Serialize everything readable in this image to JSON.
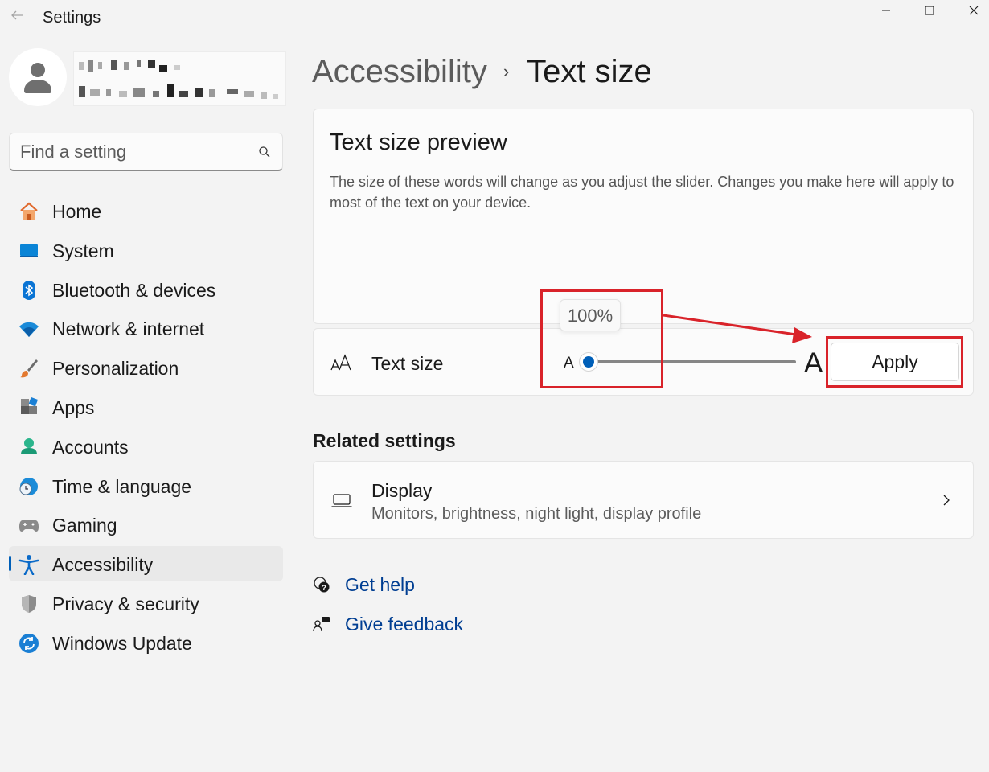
{
  "window": {
    "title": "Settings",
    "back_icon": "arrow-left-icon",
    "controls": [
      "minimize-icon",
      "maximize-icon",
      "close-icon"
    ]
  },
  "search": {
    "placeholder": "Find a setting",
    "icon": "search-icon"
  },
  "sidebar": {
    "items": [
      {
        "label": "Home",
        "icon": "home-icon"
      },
      {
        "label": "System",
        "icon": "monitor-icon"
      },
      {
        "label": "Bluetooth & devices",
        "icon": "bluetooth-icon"
      },
      {
        "label": "Network & internet",
        "icon": "wifi-icon"
      },
      {
        "label": "Personalization",
        "icon": "brush-icon"
      },
      {
        "label": "Apps",
        "icon": "apps-icon"
      },
      {
        "label": "Accounts",
        "icon": "person-icon"
      },
      {
        "label": "Time & language",
        "icon": "clock-globe-icon"
      },
      {
        "label": "Gaming",
        "icon": "gamepad-icon"
      },
      {
        "label": "Accessibility",
        "icon": "accessibility-icon",
        "active": true
      },
      {
        "label": "Privacy & security",
        "icon": "shield-icon"
      },
      {
        "label": "Windows Update",
        "icon": "update-icon"
      }
    ]
  },
  "breadcrumb": {
    "parent": "Accessibility",
    "separator": "›",
    "current": "Text size"
  },
  "preview": {
    "title": "Text size preview",
    "description": "The size of these words will change as you adjust the slider. Changes you make here will apply to most of the text on your device."
  },
  "text_size": {
    "label": "Text size",
    "icon": "text-size-icon",
    "slider_value_label": "100%",
    "slider_level": 0,
    "min_glyph": "A",
    "max_glyph": "A",
    "apply_label": "Apply"
  },
  "related": {
    "title": "Related settings",
    "display": {
      "title": "Display",
      "subtitle": "Monitors, brightness, night light, display profile",
      "icon": "laptop-icon",
      "chevron": "chevron-right-icon"
    }
  },
  "help": {
    "get_help": "Get help",
    "give_feedback": "Give feedback"
  },
  "colors": {
    "accent": "#005fb8",
    "annotation": "#d9232a",
    "link": "#003e92"
  }
}
